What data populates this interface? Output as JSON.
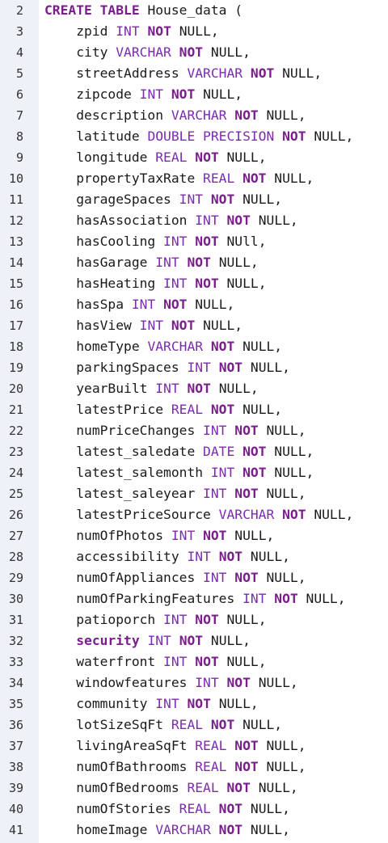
{
  "editor": {
    "lines": [
      {
        "num": "2",
        "tokens": [
          {
            "t": "CREATE TABLE",
            "c": "kw"
          },
          {
            "t": " House_data (",
            "c": "plain"
          }
        ]
      },
      {
        "num": "3",
        "tokens": [
          {
            "t": "    zpid ",
            "c": "plain"
          },
          {
            "t": "INT",
            "c": "type"
          },
          {
            "t": " ",
            "c": "plain"
          },
          {
            "t": "NOT",
            "c": "kw"
          },
          {
            "t": " NULL,",
            "c": "plain"
          }
        ]
      },
      {
        "num": "4",
        "tokens": [
          {
            "t": "    city ",
            "c": "plain"
          },
          {
            "t": "VARCHAR",
            "c": "type"
          },
          {
            "t": " ",
            "c": "plain"
          },
          {
            "t": "NOT",
            "c": "kw"
          },
          {
            "t": " NULL,",
            "c": "plain"
          }
        ]
      },
      {
        "num": "5",
        "tokens": [
          {
            "t": "    streetAddress ",
            "c": "plain"
          },
          {
            "t": "VARCHAR",
            "c": "type"
          },
          {
            "t": " ",
            "c": "plain"
          },
          {
            "t": "NOT",
            "c": "kw"
          },
          {
            "t": " NULL,",
            "c": "plain"
          }
        ]
      },
      {
        "num": "6",
        "tokens": [
          {
            "t": "    zipcode ",
            "c": "plain"
          },
          {
            "t": "INT",
            "c": "type"
          },
          {
            "t": " ",
            "c": "plain"
          },
          {
            "t": "NOT",
            "c": "kw"
          },
          {
            "t": " NULL,",
            "c": "plain"
          }
        ]
      },
      {
        "num": "7",
        "tokens": [
          {
            "t": "    description ",
            "c": "plain"
          },
          {
            "t": "VARCHAR",
            "c": "type"
          },
          {
            "t": " ",
            "c": "plain"
          },
          {
            "t": "NOT",
            "c": "kw"
          },
          {
            "t": " NULL,",
            "c": "plain"
          }
        ]
      },
      {
        "num": "8",
        "tokens": [
          {
            "t": "    latitude ",
            "c": "plain"
          },
          {
            "t": "DOUBLE PRECISION",
            "c": "type"
          },
          {
            "t": " ",
            "c": "plain"
          },
          {
            "t": "NOT",
            "c": "kw"
          },
          {
            "t": " NULL,",
            "c": "plain"
          }
        ]
      },
      {
        "num": "9",
        "tokens": [
          {
            "t": "    longitude ",
            "c": "plain"
          },
          {
            "t": "REAL",
            "c": "type"
          },
          {
            "t": " ",
            "c": "plain"
          },
          {
            "t": "NOT",
            "c": "kw"
          },
          {
            "t": " NULL,",
            "c": "plain"
          }
        ]
      },
      {
        "num": "10",
        "tokens": [
          {
            "t": "    propertyTaxRate ",
            "c": "plain"
          },
          {
            "t": "REAL",
            "c": "type"
          },
          {
            "t": " ",
            "c": "plain"
          },
          {
            "t": "NOT",
            "c": "kw"
          },
          {
            "t": " NULL,",
            "c": "plain"
          }
        ]
      },
      {
        "num": "11",
        "tokens": [
          {
            "t": "    garageSpaces ",
            "c": "plain"
          },
          {
            "t": "INT",
            "c": "type"
          },
          {
            "t": " ",
            "c": "plain"
          },
          {
            "t": "NOT",
            "c": "kw"
          },
          {
            "t": " NULL,",
            "c": "plain"
          }
        ]
      },
      {
        "num": "12",
        "tokens": [
          {
            "t": "    hasAssociation ",
            "c": "plain"
          },
          {
            "t": "INT",
            "c": "type"
          },
          {
            "t": " ",
            "c": "plain"
          },
          {
            "t": "NOT",
            "c": "kw"
          },
          {
            "t": " NULL,",
            "c": "plain"
          }
        ]
      },
      {
        "num": "13",
        "tokens": [
          {
            "t": "    hasCooling ",
            "c": "plain"
          },
          {
            "t": "INT",
            "c": "type"
          },
          {
            "t": " ",
            "c": "plain"
          },
          {
            "t": "NOT",
            "c": "kw"
          },
          {
            "t": " NUll,",
            "c": "plain"
          }
        ]
      },
      {
        "num": "14",
        "tokens": [
          {
            "t": "    hasGarage ",
            "c": "plain"
          },
          {
            "t": "INT",
            "c": "type"
          },
          {
            "t": " ",
            "c": "plain"
          },
          {
            "t": "NOT",
            "c": "kw"
          },
          {
            "t": " NULL,",
            "c": "plain"
          }
        ]
      },
      {
        "num": "15",
        "tokens": [
          {
            "t": "    hasHeating ",
            "c": "plain"
          },
          {
            "t": "INT",
            "c": "type"
          },
          {
            "t": " ",
            "c": "plain"
          },
          {
            "t": "NOT",
            "c": "kw"
          },
          {
            "t": " NULL,",
            "c": "plain"
          }
        ]
      },
      {
        "num": "16",
        "tokens": [
          {
            "t": "    hasSpa ",
            "c": "plain"
          },
          {
            "t": "INT",
            "c": "type"
          },
          {
            "t": " ",
            "c": "plain"
          },
          {
            "t": "NOT",
            "c": "kw"
          },
          {
            "t": " NULL,",
            "c": "plain"
          }
        ]
      },
      {
        "num": "17",
        "tokens": [
          {
            "t": "    hasView ",
            "c": "plain"
          },
          {
            "t": "INT",
            "c": "type"
          },
          {
            "t": " ",
            "c": "plain"
          },
          {
            "t": "NOT",
            "c": "kw"
          },
          {
            "t": " NULL,",
            "c": "plain"
          }
        ]
      },
      {
        "num": "18",
        "tokens": [
          {
            "t": "    homeType ",
            "c": "plain"
          },
          {
            "t": "VARCHAR",
            "c": "type"
          },
          {
            "t": " ",
            "c": "plain"
          },
          {
            "t": "NOT",
            "c": "kw"
          },
          {
            "t": " NULL,",
            "c": "plain"
          }
        ]
      },
      {
        "num": "19",
        "tokens": [
          {
            "t": "    parkingSpaces ",
            "c": "plain"
          },
          {
            "t": "INT",
            "c": "type"
          },
          {
            "t": " ",
            "c": "plain"
          },
          {
            "t": "NOT",
            "c": "kw"
          },
          {
            "t": " NULL,",
            "c": "plain"
          }
        ]
      },
      {
        "num": "20",
        "tokens": [
          {
            "t": "    yearBuilt ",
            "c": "plain"
          },
          {
            "t": "INT",
            "c": "type"
          },
          {
            "t": " ",
            "c": "plain"
          },
          {
            "t": "NOT",
            "c": "kw"
          },
          {
            "t": " NULL,",
            "c": "plain"
          }
        ]
      },
      {
        "num": "21",
        "tokens": [
          {
            "t": "    latestPrice ",
            "c": "plain"
          },
          {
            "t": "REAL",
            "c": "type"
          },
          {
            "t": " ",
            "c": "plain"
          },
          {
            "t": "NOT",
            "c": "kw"
          },
          {
            "t": " NULL,",
            "c": "plain"
          }
        ]
      },
      {
        "num": "22",
        "tokens": [
          {
            "t": "    numPriceChanges ",
            "c": "plain"
          },
          {
            "t": "INT",
            "c": "type"
          },
          {
            "t": " ",
            "c": "plain"
          },
          {
            "t": "NOT",
            "c": "kw"
          },
          {
            "t": " NULL,",
            "c": "plain"
          }
        ]
      },
      {
        "num": "23",
        "tokens": [
          {
            "t": "    latest_saledate ",
            "c": "plain"
          },
          {
            "t": "DATE",
            "c": "type"
          },
          {
            "t": " ",
            "c": "plain"
          },
          {
            "t": "NOT",
            "c": "kw"
          },
          {
            "t": " NULL,",
            "c": "plain"
          }
        ]
      },
      {
        "num": "24",
        "tokens": [
          {
            "t": "    latest_salemonth ",
            "c": "plain"
          },
          {
            "t": "INT",
            "c": "type"
          },
          {
            "t": " ",
            "c": "plain"
          },
          {
            "t": "NOT",
            "c": "kw"
          },
          {
            "t": " NULL,",
            "c": "plain"
          }
        ]
      },
      {
        "num": "25",
        "tokens": [
          {
            "t": "    latest_saleyear ",
            "c": "plain"
          },
          {
            "t": "INT",
            "c": "type"
          },
          {
            "t": " ",
            "c": "plain"
          },
          {
            "t": "NOT",
            "c": "kw"
          },
          {
            "t": " NULL,",
            "c": "plain"
          }
        ]
      },
      {
        "num": "26",
        "tokens": [
          {
            "t": "    latestPriceSource ",
            "c": "plain"
          },
          {
            "t": "VARCHAR",
            "c": "type"
          },
          {
            "t": " ",
            "c": "plain"
          },
          {
            "t": "NOT",
            "c": "kw"
          },
          {
            "t": " NULL,",
            "c": "plain"
          }
        ]
      },
      {
        "num": "27",
        "tokens": [
          {
            "t": "    numOfPhotos ",
            "c": "plain"
          },
          {
            "t": "INT",
            "c": "type"
          },
          {
            "t": " ",
            "c": "plain"
          },
          {
            "t": "NOT",
            "c": "kw"
          },
          {
            "t": " NULL,",
            "c": "plain"
          }
        ]
      },
      {
        "num": "28",
        "tokens": [
          {
            "t": "    accessibility ",
            "c": "plain"
          },
          {
            "t": "INT",
            "c": "type"
          },
          {
            "t": " ",
            "c": "plain"
          },
          {
            "t": "NOT",
            "c": "kw"
          },
          {
            "t": " NULL,",
            "c": "plain"
          }
        ]
      },
      {
        "num": "29",
        "tokens": [
          {
            "t": "    numOfAppliances ",
            "c": "plain"
          },
          {
            "t": "INT",
            "c": "type"
          },
          {
            "t": " ",
            "c": "plain"
          },
          {
            "t": "NOT",
            "c": "kw"
          },
          {
            "t": " NULL,",
            "c": "plain"
          }
        ]
      },
      {
        "num": "30",
        "tokens": [
          {
            "t": "    numOfParkingFeatures ",
            "c": "plain"
          },
          {
            "t": "INT",
            "c": "type"
          },
          {
            "t": " ",
            "c": "plain"
          },
          {
            "t": "NOT",
            "c": "kw"
          },
          {
            "t": " NULL,",
            "c": "plain"
          }
        ]
      },
      {
        "num": "31",
        "tokens": [
          {
            "t": "    patioporch ",
            "c": "plain"
          },
          {
            "t": "INT",
            "c": "type"
          },
          {
            "t": " ",
            "c": "plain"
          },
          {
            "t": "NOT",
            "c": "kw"
          },
          {
            "t": " NULL,",
            "c": "plain"
          }
        ]
      },
      {
        "num": "32",
        "tokens": [
          {
            "t": "    ",
            "c": "plain"
          },
          {
            "t": "security",
            "c": "kw"
          },
          {
            "t": " ",
            "c": "plain"
          },
          {
            "t": "INT",
            "c": "type"
          },
          {
            "t": " ",
            "c": "plain"
          },
          {
            "t": "NOT",
            "c": "kw"
          },
          {
            "t": " NULL,",
            "c": "plain"
          }
        ]
      },
      {
        "num": "33",
        "tokens": [
          {
            "t": "    waterfront ",
            "c": "plain"
          },
          {
            "t": "INT",
            "c": "type"
          },
          {
            "t": " ",
            "c": "plain"
          },
          {
            "t": "NOT",
            "c": "kw"
          },
          {
            "t": " NULL,",
            "c": "plain"
          }
        ]
      },
      {
        "num": "34",
        "tokens": [
          {
            "t": "    windowfeatures ",
            "c": "plain"
          },
          {
            "t": "INT",
            "c": "type"
          },
          {
            "t": " ",
            "c": "plain"
          },
          {
            "t": "NOT",
            "c": "kw"
          },
          {
            "t": " NULL,",
            "c": "plain"
          }
        ]
      },
      {
        "num": "35",
        "tokens": [
          {
            "t": "    community ",
            "c": "plain"
          },
          {
            "t": "INT",
            "c": "type"
          },
          {
            "t": " ",
            "c": "plain"
          },
          {
            "t": "NOT",
            "c": "kw"
          },
          {
            "t": " NULL,",
            "c": "plain"
          }
        ]
      },
      {
        "num": "36",
        "tokens": [
          {
            "t": "    lotSizeSqFt ",
            "c": "plain"
          },
          {
            "t": "REAL",
            "c": "type"
          },
          {
            "t": " ",
            "c": "plain"
          },
          {
            "t": "NOT",
            "c": "kw"
          },
          {
            "t": " NULL,",
            "c": "plain"
          }
        ]
      },
      {
        "num": "37",
        "tokens": [
          {
            "t": "    livingAreaSqFt ",
            "c": "plain"
          },
          {
            "t": "REAL",
            "c": "type"
          },
          {
            "t": " ",
            "c": "plain"
          },
          {
            "t": "NOT",
            "c": "kw"
          },
          {
            "t": " NULL,",
            "c": "plain"
          }
        ]
      },
      {
        "num": "38",
        "tokens": [
          {
            "t": "    numOfBathrooms ",
            "c": "plain"
          },
          {
            "t": "REAL",
            "c": "type"
          },
          {
            "t": " ",
            "c": "plain"
          },
          {
            "t": "NOT",
            "c": "kw"
          },
          {
            "t": " NULL,",
            "c": "plain"
          }
        ]
      },
      {
        "num": "39",
        "tokens": [
          {
            "t": "    numOfBedrooms ",
            "c": "plain"
          },
          {
            "t": "REAL",
            "c": "type"
          },
          {
            "t": " ",
            "c": "plain"
          },
          {
            "t": "NOT",
            "c": "kw"
          },
          {
            "t": " NULL,",
            "c": "plain"
          }
        ]
      },
      {
        "num": "40",
        "tokens": [
          {
            "t": "    numOfStories ",
            "c": "plain"
          },
          {
            "t": "REAL",
            "c": "type"
          },
          {
            "t": " ",
            "c": "plain"
          },
          {
            "t": "NOT",
            "c": "kw"
          },
          {
            "t": " NULL,",
            "c": "plain"
          }
        ]
      },
      {
        "num": "41",
        "tokens": [
          {
            "t": "    homeImage ",
            "c": "plain"
          },
          {
            "t": "VARCHAR",
            "c": "type"
          },
          {
            "t": " ",
            "c": "plain"
          },
          {
            "t": "NOT",
            "c": "kw"
          },
          {
            "t": " NULL,",
            "c": "plain"
          }
        ]
      }
    ]
  },
  "colors": {
    "keyword": "#7a1e8c",
    "type": "#7b2bb0",
    "text": "#1a1a1a",
    "gutter_bg": "#eef2f8",
    "line_number": "#333333",
    "background": "#ffffff"
  }
}
